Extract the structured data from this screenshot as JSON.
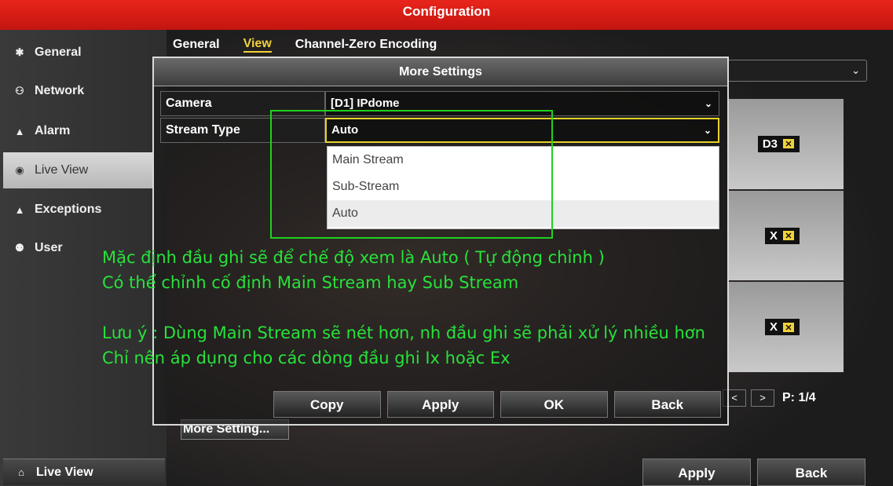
{
  "window": {
    "title": "Configuration"
  },
  "sidebar": {
    "items": [
      {
        "label": "General",
        "icon": "gear-icon"
      },
      {
        "label": "Network",
        "icon": "network-icon"
      },
      {
        "label": "Alarm",
        "icon": "alarm-icon"
      },
      {
        "label": "Live View",
        "icon": "eye-icon"
      },
      {
        "label": "Exceptions",
        "icon": "warning-icon"
      },
      {
        "label": "User",
        "icon": "users-icon"
      }
    ],
    "bottom": {
      "label": "Live View",
      "icon": "home-icon"
    }
  },
  "tabs": [
    {
      "label": "General"
    },
    {
      "label": "View"
    },
    {
      "label": "Channel-Zero Encoding"
    }
  ],
  "grid": {
    "cells": [
      {
        "label": "D3"
      },
      {
        "label": "X"
      },
      {
        "label": "X"
      }
    ],
    "x_glyph": "✕"
  },
  "pager": {
    "prev": "<",
    "next": ">",
    "page": "P: 1/4"
  },
  "more_setting_button": "More Setting...",
  "footer": {
    "apply": "Apply",
    "back": "Back"
  },
  "dialog": {
    "title": "More Settings",
    "camera": {
      "label": "Camera",
      "value": "[D1] IPdome"
    },
    "stream_type": {
      "label": "Stream Type",
      "value": "Auto",
      "options": [
        "Main Stream",
        "Sub-Stream",
        "Auto"
      ]
    },
    "buttons": {
      "copy": "Copy",
      "apply": "Apply",
      "ok": "OK",
      "back": "Back"
    }
  },
  "notes": [
    "Mặc định đầu ghi sẽ để chế độ xem là Auto ( Tự động chỉnh )",
    "Có thể chỉnh cố định Main Stream hay Sub Stream",
    "Lưu ý : Dùng Main Stream sẽ nét hơn, nh đầu ghi sẽ phải xử lý nhiều hơn",
    "Chỉ nên áp dụng cho các dòng đầu ghi Ix hoặc Ex"
  ],
  "colors": {
    "titlebar": "#d81e16",
    "accent": "#f1d23a",
    "note": "#27e23a"
  }
}
